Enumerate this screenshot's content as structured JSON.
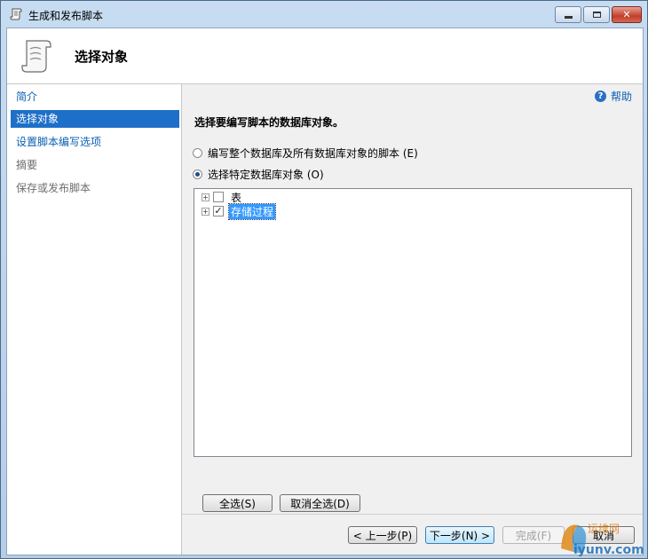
{
  "window": {
    "title": "生成和发布脚本"
  },
  "header": {
    "title": "选择对象"
  },
  "sidebar": {
    "items": [
      {
        "label": "简介",
        "state": "link"
      },
      {
        "label": "选择对象",
        "state": "active"
      },
      {
        "label": "设置脚本编写选项",
        "state": "link"
      },
      {
        "label": "摘要",
        "state": "disabled"
      },
      {
        "label": "保存或发布脚本",
        "state": "disabled"
      }
    ]
  },
  "main": {
    "help_label": "帮助",
    "section_title": "选择要编写脚本的数据库对象。",
    "radio_whole": {
      "label": "编写整个数据库及所有数据库对象的脚本 (E)",
      "checked": false
    },
    "radio_specific": {
      "label": "选择特定数据库对象 (O)",
      "checked": true
    },
    "tree": [
      {
        "label": "表",
        "checked": false,
        "selected": false
      },
      {
        "label": "存储过程",
        "checked": true,
        "selected": true
      }
    ],
    "select_all_label": "全选(S)",
    "deselect_all_label": "取消全选(D)"
  },
  "footer": {
    "prev_label": "< 上一步(P)",
    "next_label": "下一步(N) >",
    "finish_label": "完成(F)",
    "cancel_label": "取消"
  },
  "watermark": {
    "text": "iyunv.com",
    "text2": "运维网"
  },
  "colors": {
    "accent": "#1e6fc8",
    "link": "#0b5fb3",
    "selection": "#3399ff"
  }
}
